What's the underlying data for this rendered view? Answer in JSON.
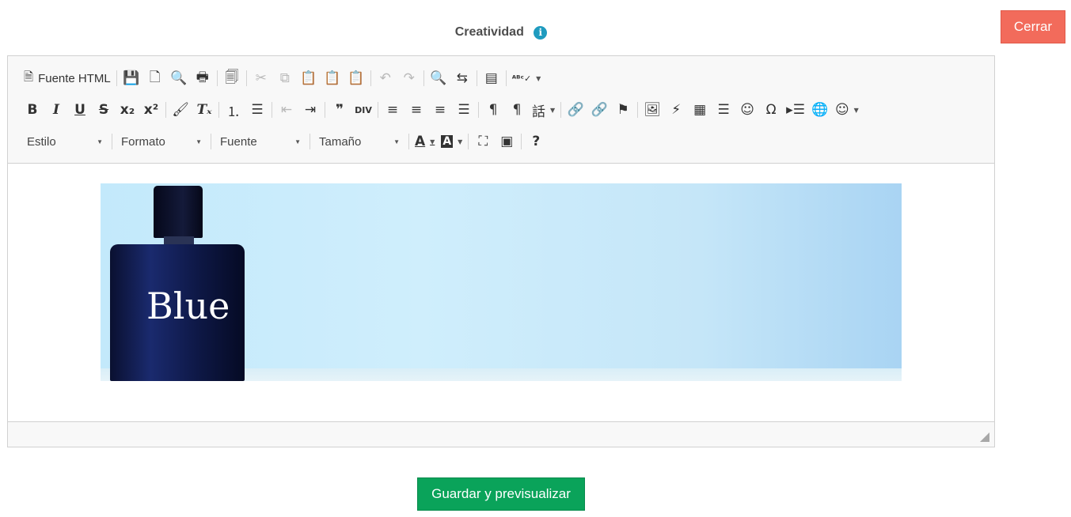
{
  "header": {
    "title": "Creatividad",
    "info_icon": "info-icon",
    "close_label": "Cerrar",
    "close_color": "#f26b5b"
  },
  "toolbar": {
    "source_label": "Fuente HTML",
    "style_label": "Estilo",
    "format_label": "Formato",
    "font_label": "Fuente",
    "size_label": "Tamaño",
    "bold_label": "B",
    "italic_label": "I",
    "underline_label": "U",
    "strike_label": "S",
    "help_label": "?",
    "omega_label": "Ω"
  },
  "content": {
    "image_text": "Blue"
  },
  "footer": {
    "save_label": "Guardar y previsualizar",
    "save_color": "#0aa35a"
  }
}
